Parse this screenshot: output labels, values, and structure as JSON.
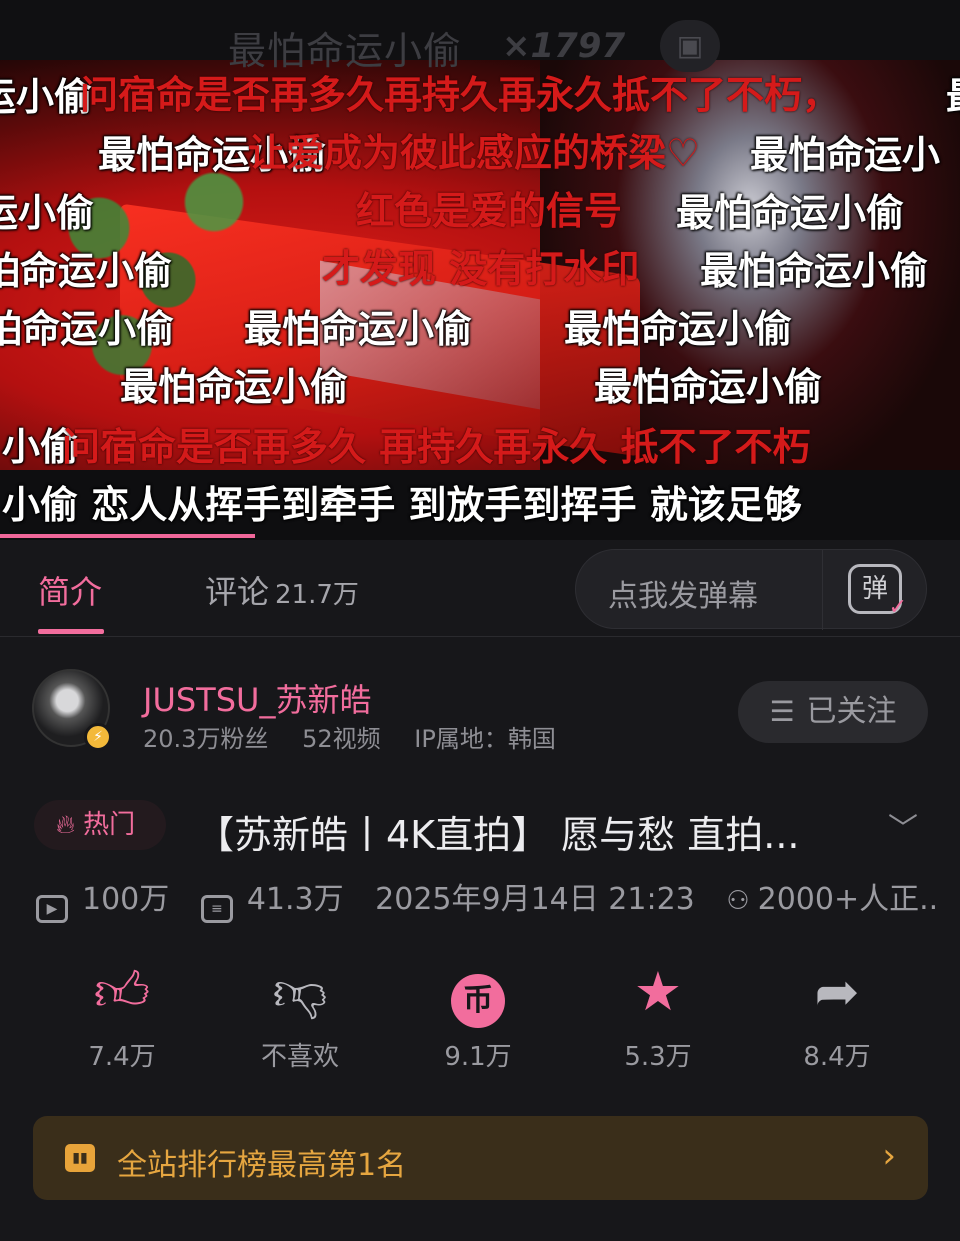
{
  "video": {
    "overlay_title": "最怕命运小偷",
    "overlay_count": "×1797",
    "danmaku": [
      {
        "text": "运小偷",
        "color": "white"
      },
      {
        "text": "问宿命是否再多久再持久再永久抵不了不朽，",
        "color": "red"
      },
      {
        "text": "最",
        "color": "white"
      },
      {
        "text": "最怕命运小偷",
        "color": "white"
      },
      {
        "text": "让爱成为彼此感应的桥梁♡",
        "color": "red"
      },
      {
        "text": "最怕命运小",
        "color": "white"
      },
      {
        "text": "运小偷",
        "color": "white"
      },
      {
        "text": "红色是爱的信号",
        "color": "red"
      },
      {
        "text": "最怕命运小偷",
        "color": "white"
      },
      {
        "text": "怕命运小偷",
        "color": "white"
      },
      {
        "text": "才发现 没有打水印",
        "color": "red"
      },
      {
        "text": "最怕命运小偷",
        "color": "white"
      },
      {
        "text": "怕命运小偷",
        "color": "white"
      },
      {
        "text": "最怕命运小偷",
        "color": "white"
      },
      {
        "text": "最怕命运小偷",
        "color": "white"
      },
      {
        "text": "最怕命运小偷",
        "color": "white"
      },
      {
        "text": "最怕命运小偷",
        "color": "white"
      },
      {
        "text": "小偷",
        "color": "white"
      },
      {
        "text": "问宿命是否再多久 再持久再永久 抵不了不朽",
        "color": "red"
      },
      {
        "text": "小偷 恋人从挥手到牵手 到放手到挥手 就该足够",
        "color": "white"
      }
    ]
  },
  "tabs": {
    "intro": "简介",
    "comments": "评论",
    "comments_count": "21.7万",
    "danmaku_placeholder": "点我发弹幕",
    "danmaku_icon": "弹"
  },
  "uploader": {
    "name": "JUSTSU_苏新皓",
    "fans": "20.3万粉丝",
    "videos": "52视频",
    "ip": "IP属地：韩国",
    "follow_label": "已关注"
  },
  "title": {
    "hot_label": "热门",
    "text": "【苏新皓丨4K直拍】 愿与愁 直拍..."
  },
  "meta": {
    "plays": "100万",
    "danmaku_count": "41.3万",
    "datetime": "2025年9月14日 21:23",
    "watching": "2000+人正.."
  },
  "actions": {
    "like": "7.4万",
    "dislike": "不喜欢",
    "coin": "9.1万",
    "favorite": "5.3万",
    "share": "8.4万"
  },
  "ranking": {
    "text": "全站排行榜最高第1名"
  },
  "colors": {
    "accent": "#f26d9d",
    "background": "#17171a",
    "ranking_text": "#e6a640",
    "danmaku_red": "#d51a1a"
  }
}
